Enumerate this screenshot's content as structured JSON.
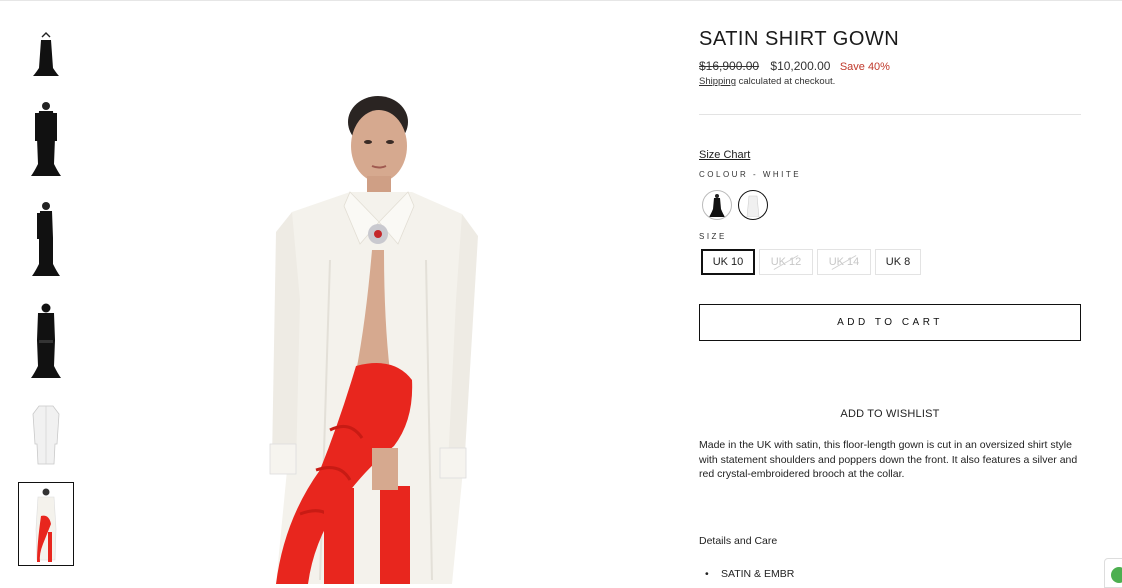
{
  "product": {
    "title": "SATIN SHIRT GOWN",
    "price_original": "$16,900.00",
    "price_sale": "$10,200.00",
    "save_label": "Save 40%",
    "shipping_link": "Shipping",
    "shipping_text": " calculated at checkout."
  },
  "options": {
    "size_chart_label": "Size Chart",
    "colour_label": "COLOUR - WHITE",
    "colour_swatches": [
      "black",
      "white"
    ],
    "selected_colour": "white",
    "size_label": "SIZE",
    "sizes": [
      {
        "label": "UK 10",
        "available": true,
        "selected": true
      },
      {
        "label": "UK 12",
        "available": false,
        "selected": false
      },
      {
        "label": "UK 14",
        "available": false,
        "selected": false
      },
      {
        "label": "UK 8",
        "available": true,
        "selected": false
      }
    ]
  },
  "actions": {
    "add_to_cart": "ADD TO CART",
    "add_to_wishlist": "ADD TO WISHLIST"
  },
  "description": "Made in the UK with satin, this floor-length gown is cut in an oversized shirt style with statement shoulders and poppers down the front. It also features a silver and red crystal-embroidered brooch at the collar.",
  "details": {
    "title": "Details and Care",
    "items": [
      "SATIN & EMBR"
    ]
  },
  "gallery": {
    "thumbnails": [
      "black-gown-hem",
      "black-gown-front",
      "black-gown-side",
      "black-gown-back",
      "white-gown-flat",
      "white-gown-red-ruffle"
    ],
    "selected_index": 5,
    "up_icon": "chevron-up-icon"
  },
  "colors": {
    "text": "#1c1c1c",
    "sale_red": "#c0392b",
    "border": "#111111",
    "gown_white": "#f4f2ec",
    "ruffle_red": "#e8261e",
    "chat_green": "#4caf50"
  }
}
